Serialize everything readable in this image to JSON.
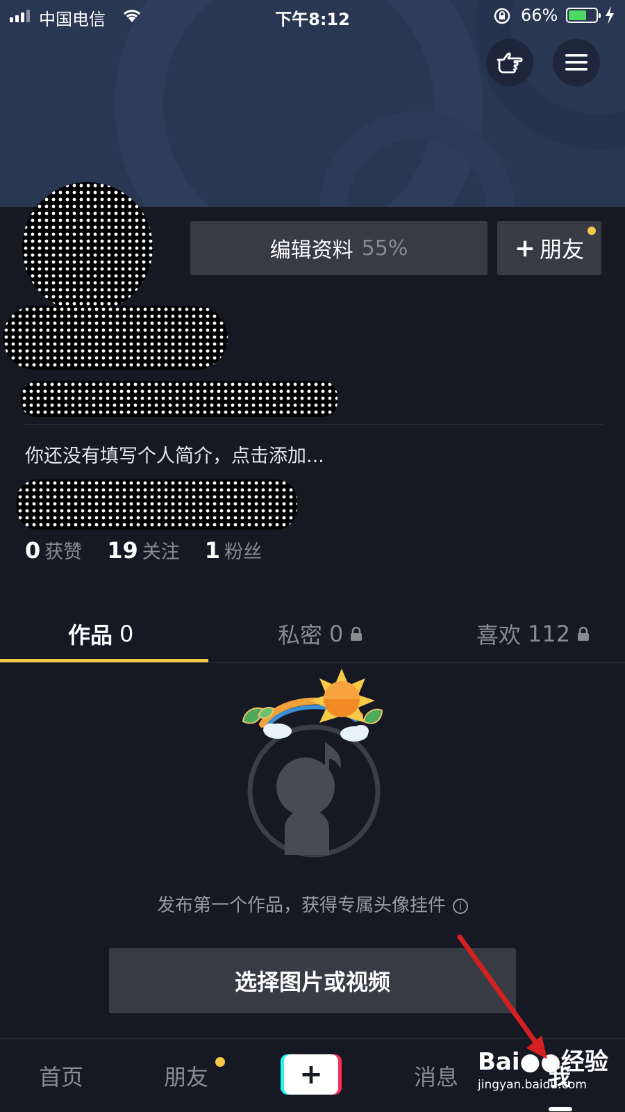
{
  "status_bar": {
    "carrier": "中国电信",
    "time": "下午8:12",
    "battery_percent": "66%",
    "battery_level": 0.66
  },
  "header": {
    "icons": [
      "hand-point-icon",
      "menu-icon"
    ]
  },
  "profile": {
    "edit_label": "编辑资料",
    "edit_progress": "55%",
    "add_friend_label": "朋友",
    "add_friend_plus": "+",
    "bio_placeholder": "你还没有填写个人简介，点击添加...",
    "stats": [
      {
        "value": "0",
        "label": "获赞"
      },
      {
        "value": "19",
        "label": "关注"
      },
      {
        "value": "1",
        "label": "粉丝"
      }
    ]
  },
  "tabs": [
    {
      "label": "作品",
      "count": "0",
      "active": true,
      "locked": false
    },
    {
      "label": "私密",
      "count": "0",
      "active": false,
      "locked": true
    },
    {
      "label": "喜欢",
      "count": "112",
      "active": false,
      "locked": true
    }
  ],
  "empty_state": {
    "message": "发布第一个作品，获得专属头像挂件",
    "info_icon": "i",
    "button_label": "选择图片或视频"
  },
  "bottom_nav": {
    "items": [
      "首页",
      "朋友",
      "消息",
      "我"
    ],
    "create_symbol": "+"
  },
  "watermark": {
    "brand": "Bai",
    "brand_suffix": "经验",
    "url": "jingyan.baidu.com"
  },
  "colors": {
    "background": "#161823",
    "accent": "#f7c948",
    "button": "#393b44",
    "arrow": "#d42020"
  }
}
